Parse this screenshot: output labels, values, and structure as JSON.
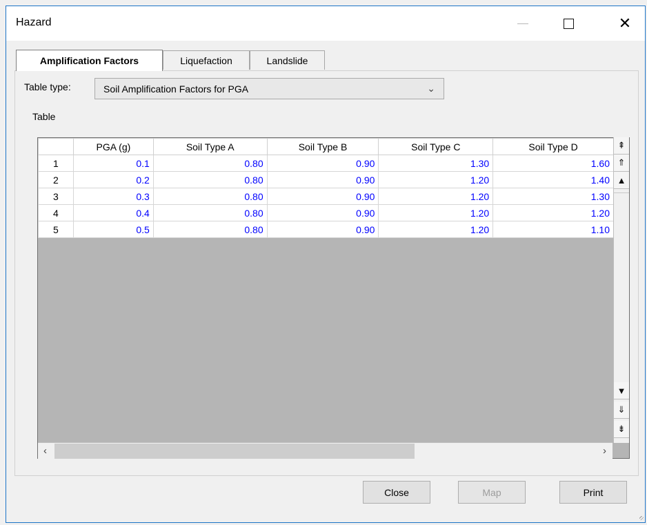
{
  "window": {
    "title": "Hazard",
    "controls": {
      "minimize": "—",
      "maximize": "□",
      "close": "✕"
    }
  },
  "tabs": [
    {
      "label": "Amplification Factors",
      "active": true
    },
    {
      "label": "Liquefaction",
      "active": false
    },
    {
      "label": "Landslide",
      "active": false
    }
  ],
  "table_type": {
    "label": "Table type:",
    "selected": "Soil Amplification Factors for PGA"
  },
  "table": {
    "label": "Table",
    "headers": [
      "PGA (g)",
      "Soil Type A",
      "Soil Type B",
      "Soil Type C",
      "Soil Type D"
    ],
    "rows": [
      {
        "index": "1",
        "cells": [
          "0.1",
          "0.80",
          "0.90",
          "1.30",
          "1.60"
        ]
      },
      {
        "index": "2",
        "cells": [
          "0.2",
          "0.80",
          "0.90",
          "1.20",
          "1.40"
        ]
      },
      {
        "index": "3",
        "cells": [
          "0.3",
          "0.80",
          "0.90",
          "1.20",
          "1.30"
        ]
      },
      {
        "index": "4",
        "cells": [
          "0.4",
          "0.80",
          "0.90",
          "1.20",
          "1.20"
        ]
      },
      {
        "index": "5",
        "cells": [
          "0.5",
          "0.80",
          "0.90",
          "1.20",
          "1.10"
        ]
      }
    ]
  },
  "scrollbar": {
    "top": "⇞",
    "page_up": "⇑",
    "up": "▲",
    "down": "▼",
    "page_down": "⇓",
    "bottom": "⇟"
  },
  "buttons": {
    "close": "Close",
    "map": "Map",
    "print": "Print"
  },
  "colors": {
    "value_text": "#0000ff",
    "grid_background": "#b5b5b5"
  }
}
